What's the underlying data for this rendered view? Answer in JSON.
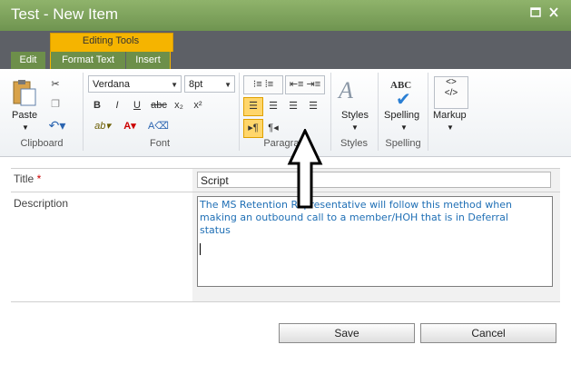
{
  "window": {
    "title": "Test - New Item",
    "maximize_icon": "maximize-icon",
    "close_icon": "close-icon"
  },
  "ribbon": {
    "context_group": "Editing Tools",
    "tabs": [
      {
        "label": "Edit"
      },
      {
        "label": "Format Text",
        "selected": true
      },
      {
        "label": "Insert"
      }
    ],
    "groups": {
      "clipboard": {
        "label": "Clipboard",
        "paste_label": "Paste",
        "icons": [
          "paste-icon",
          "cut-icon",
          "copy-icon",
          "undo-icon"
        ]
      },
      "font": {
        "label": "Font",
        "font_name": "Verdana",
        "font_size": "8pt",
        "bold": "B",
        "italic": "I",
        "underline": "U",
        "strike": "abc",
        "sub": "x₂",
        "sup": "x²",
        "icons": [
          "highlight-icon",
          "font-color-icon",
          "clear-format-icon"
        ]
      },
      "paragraph": {
        "label": "Paragraph",
        "icons": [
          "bullets-icon",
          "numbering-icon",
          "outdent-icon",
          "indent-icon",
          "align-left-icon",
          "align-center-icon",
          "align-right-icon",
          "justify-icon",
          "ltr-icon",
          "rtl-icon"
        ]
      },
      "styles": {
        "label": "Styles",
        "button_label": "Styles"
      },
      "spelling": {
        "label": "Spelling",
        "button_label": "Spelling",
        "abc": "ABC"
      },
      "markup": {
        "button_label": "Markup",
        "tag": "<>",
        "tag2": "</>"
      }
    }
  },
  "form": {
    "title_label": "Title",
    "required_marker": "*",
    "title_value": "Script",
    "description_label": "Description",
    "description_value": "The MS Retention Representative will follow this method when making an outbound call to a member/HOH that is in Deferral status",
    "save_label": "Save",
    "cancel_label": "Cancel"
  },
  "colors": {
    "titlebar": "#7a9b5b",
    "context_tab": "#f5b400",
    "text_blue": "#1f6fb5"
  }
}
